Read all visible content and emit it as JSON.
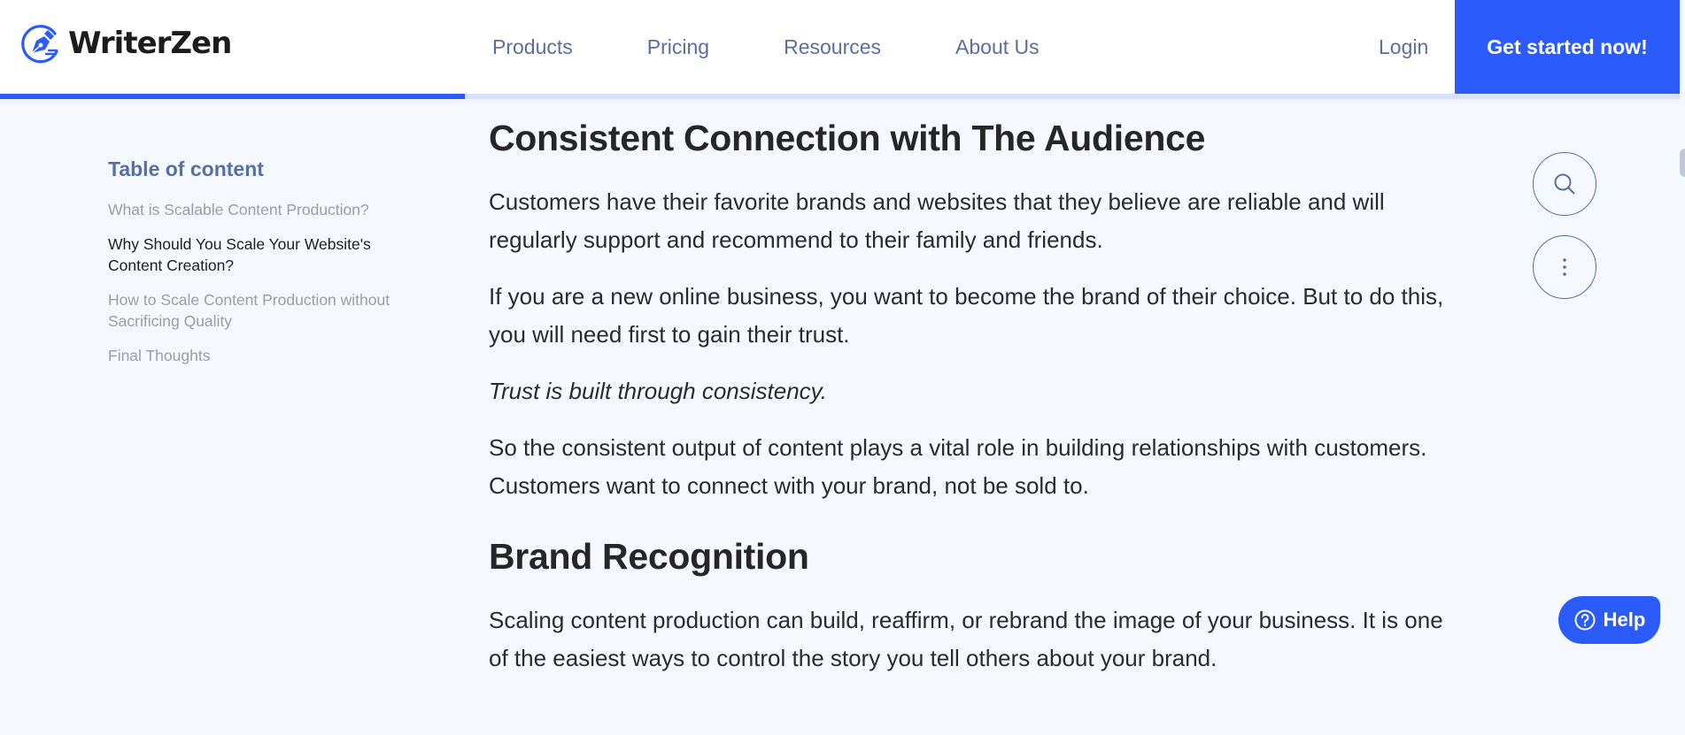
{
  "brand": {
    "name": "WriterZen",
    "icon": "pen-nib-logo-icon",
    "accent_color": "#2b5cfb"
  },
  "nav": {
    "items": [
      {
        "label": "Products"
      },
      {
        "label": "Pricing"
      },
      {
        "label": "Resources"
      },
      {
        "label": "About Us"
      }
    ],
    "login_label": "Login",
    "cta_label": "Get started now!"
  },
  "reading_progress": {
    "percent": 27.7
  },
  "toc": {
    "title": "Table of content",
    "items": [
      {
        "label": "What is Scalable Content Production?",
        "active": false
      },
      {
        "label": "Why Should You Scale Your Website's Content Creation?",
        "active": true
      },
      {
        "label": "How to Scale Content Production without Sacrificing Quality",
        "active": false
      },
      {
        "label": "Final Thoughts",
        "active": false
      }
    ]
  },
  "article": {
    "heading_1": "Consistent Connection with The Audience",
    "paragraphs_1": [
      "Customers have their favorite brands and websites that they believe are reliable and will regularly support and recommend to their family and friends.",
      "If you are a new online business, you want to become the brand of their choice. But to do this, you will need first to gain their trust.",
      "Trust is built through consistency.",
      "So the consistent output of content plays a vital role in building relationships with customers. Customers want to connect with your brand, not be sold to."
    ],
    "heading_2": "Brand Recognition",
    "paragraphs_2": [
      "Scaling content production can build, reaffirm, or rebrand the image of your business. It is one of the easiest ways to control the story you tell others about your brand."
    ]
  },
  "floating_actions": {
    "search_icon": "search-icon",
    "more_icon": "more-vertical-icon"
  },
  "help": {
    "label": "Help",
    "icon": "question-circle-icon"
  }
}
